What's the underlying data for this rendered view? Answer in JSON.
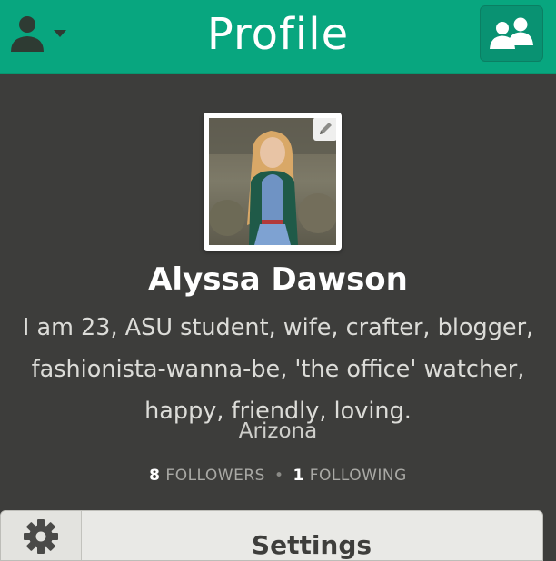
{
  "header": {
    "title": "Profile",
    "user_menu_icon": "user-dropdown-icon",
    "friends_icon": "people-icon",
    "color": "#08a67f"
  },
  "profile": {
    "name": "Alyssa Dawson",
    "bio": "I am 23, ASU student, wife, crafter, blogger, fashionista-wanna-be, 'the office' watcher, happy, friendly, loving.",
    "location": "Arizona",
    "followers_count": "8",
    "followers_label": "FOLLOWERS",
    "following_count": "1",
    "following_label": "FOLLOWING"
  },
  "bottom": {
    "settings_label": "Settings",
    "gear_icon": "gear-icon"
  }
}
